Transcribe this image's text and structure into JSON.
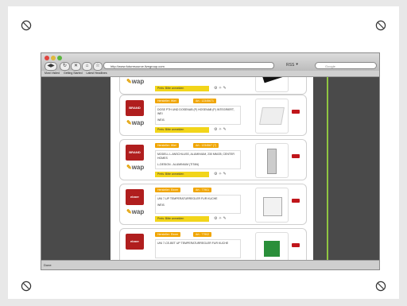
{
  "browser": {
    "url": "http://www.futuresource.livegroup.com",
    "search_placeholder": "Google",
    "rss_label": "RSS ⯆",
    "bookmarks": [
      "Most Visited",
      "Getting Started",
      "Latest Headlines"
    ],
    "status": "Done"
  },
  "products": [
    {
      "brand_logo": "",
      "wap_label": "wap",
      "hdr1": "",
      "hdr2": "",
      "desc1": "",
      "desc2": "",
      "bar_label": "Preis: Bitte anmelden",
      "thumb": "black"
    },
    {
      "brand_logo": "BRAND",
      "wap_label": "wap",
      "hdr1": "Hersteller: Wiel",
      "hdr2": "Art.: 12345671",
      "desc1": "DOSE PTH UND DOSENAB (P) HOSENAB (P) INTEGRIERT, WEI",
      "desc2": "WEIß",
      "bar_label": "Preis: Bitte anmelden",
      "thumb": "box"
    },
    {
      "brand_logo": "BRAND",
      "wap_label": "wap",
      "hdr1": "Hersteller: Wiel",
      "hdr2": "Art.: 1234567 (7)",
      "desc1": "MODELL L-ANSCHLUSS, ALUMINIUM, 230 MM/25, CENTER HOMES",
      "desc2": "L-DESIGN - ALUMINIUM (TITAN)",
      "bar_label": "Preis: Bitte anmelden",
      "thumb": "panel"
    },
    {
      "brand_logo": "ebner",
      "wap_label": "wap",
      "hdr1": "Hersteller: Ebner",
      "hdr2": "Art.: 77901",
      "desc1": "UNI 7-UP TEMPERATURREGLER FUR KUCHE",
      "desc2": "WEIß",
      "bar_label": "Preis: Bitte anmelden",
      "thumb": "thermo"
    },
    {
      "brand_logo": "ebner",
      "wap_label": "wap",
      "hdr1": "Hersteller: Ebner",
      "hdr2": "Art.: 77902",
      "desc1": "UNI 7-CE-BET UP TEMPERATURREGLER FUR KUCHE",
      "desc2": "",
      "bar_label": "Preis: Bitte anmelden",
      "thumb": "green"
    }
  ]
}
